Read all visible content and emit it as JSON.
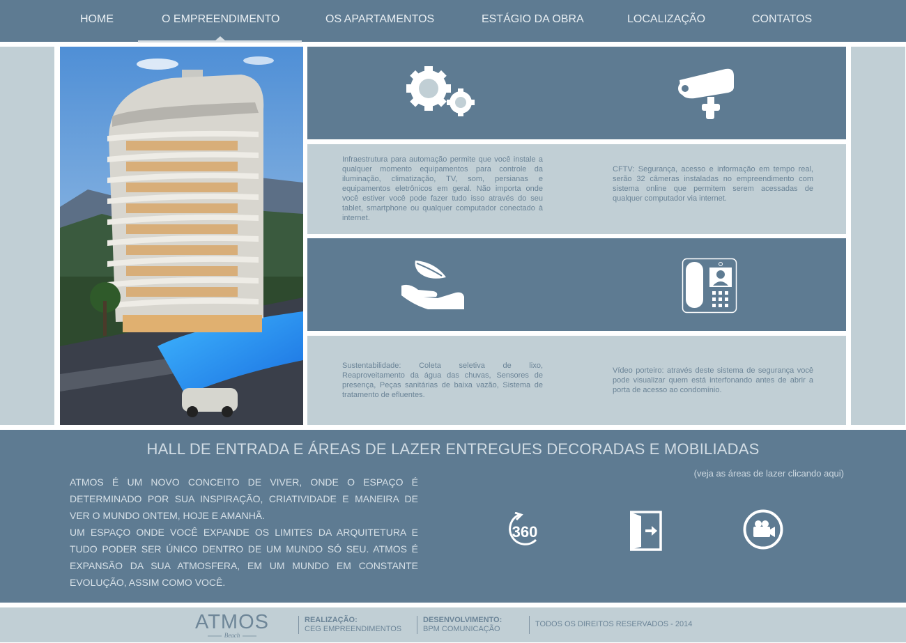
{
  "nav": {
    "items": [
      {
        "label": "HOME"
      },
      {
        "label": "O EMPREENDIMENTO"
      },
      {
        "label": "OS APARTAMENTOS"
      },
      {
        "label": "ESTÁGIO DA OBRA"
      },
      {
        "label": "LOCALIZAÇÃO"
      },
      {
        "label": "CONTATOS"
      }
    ],
    "active_index": 1
  },
  "features": [
    {
      "icon": "gears-icon",
      "text": "Infraestrutura para automação permite que você instale a qualquer momento equipamentos para controle da iluminação, climatização, TV, som, persianas e equipamentos eletrônicos em geral. Não importa onde você estiver você pode fazer tudo isso através do seu tablet, smartphone ou qualquer computador conectado à internet."
    },
    {
      "icon": "security-camera-icon",
      "text": "CFTV: Segurança, acesso e informação em tempo real, serão 32 câmeras instaladas no empreendimento com sistema online que permitem serem acessadas de qualquer computador via internet."
    },
    {
      "icon": "hand-leaf-icon",
      "text": "Sustentabilidade: Coleta seletiva de lixo, Reaproveitamento da água das chuvas, Sensores de presença, Peças sanitárias de baixa vazão, Sistema de tratamento de efluentes."
    },
    {
      "icon": "video-intercom-icon",
      "text": "Vídeo porteiro: através deste sistema de segurança você pode visualizar quem está interfonando antes de abrir a porta de acesso ao condomínio."
    }
  ],
  "hall": {
    "title": "HALL DE ENTRADA E ÁREAS DE LAZER ENTREGUES DECORADAS E MOBILIADAS",
    "paragraph1": "ATMOS É UM NOVO CONCEITO DE VIVER, ONDE O ESPAÇO É DETERMINADO POR SUA INSPIRAÇÃO, CRIATIVIDADE E MANEIRA DE VER O MUNDO ONTEM, HOJE E AMANHÃ.",
    "paragraph2": "UM ESPAÇO ONDE VOCÊ EXPANDE OS LIMITES DA ARQUITETURA E TUDO PODER SER ÚNICO DENTRO DE UM MUNDO SÓ SEU. ATMOS É EXPANSÃO DA SUA ATMOSFERA, EM UM MUNDO EM CONSTANTE EVOLUÇÃO, ASSIM COMO VOCÊ.",
    "leisure_link": "(veja as áreas de lazer clicando aqui)",
    "buttons": [
      {
        "icon": "view-360-icon",
        "label": "360"
      },
      {
        "icon": "enter-door-icon"
      },
      {
        "icon": "video-camera-icon"
      }
    ]
  },
  "footer": {
    "logo_text": "ATMOS",
    "logo_subtext": "Beach",
    "realizacao_label": "REALIZAÇÃO:",
    "realizacao_value": "CEG EMPREENDIMENTOS",
    "desenvolvimento_label": "DESENVOLVIMENTO:",
    "desenvolvimento_value": "BPM COMUNICAÇÃO",
    "rights": "TODOS OS DIREITOS RESERVADOS - 2014"
  },
  "colors": {
    "dark_panel": "#5e7b92",
    "light_panel": "#c1cfd5",
    "nav_text": "#e9eff3",
    "body_text": "#6b8497"
  }
}
